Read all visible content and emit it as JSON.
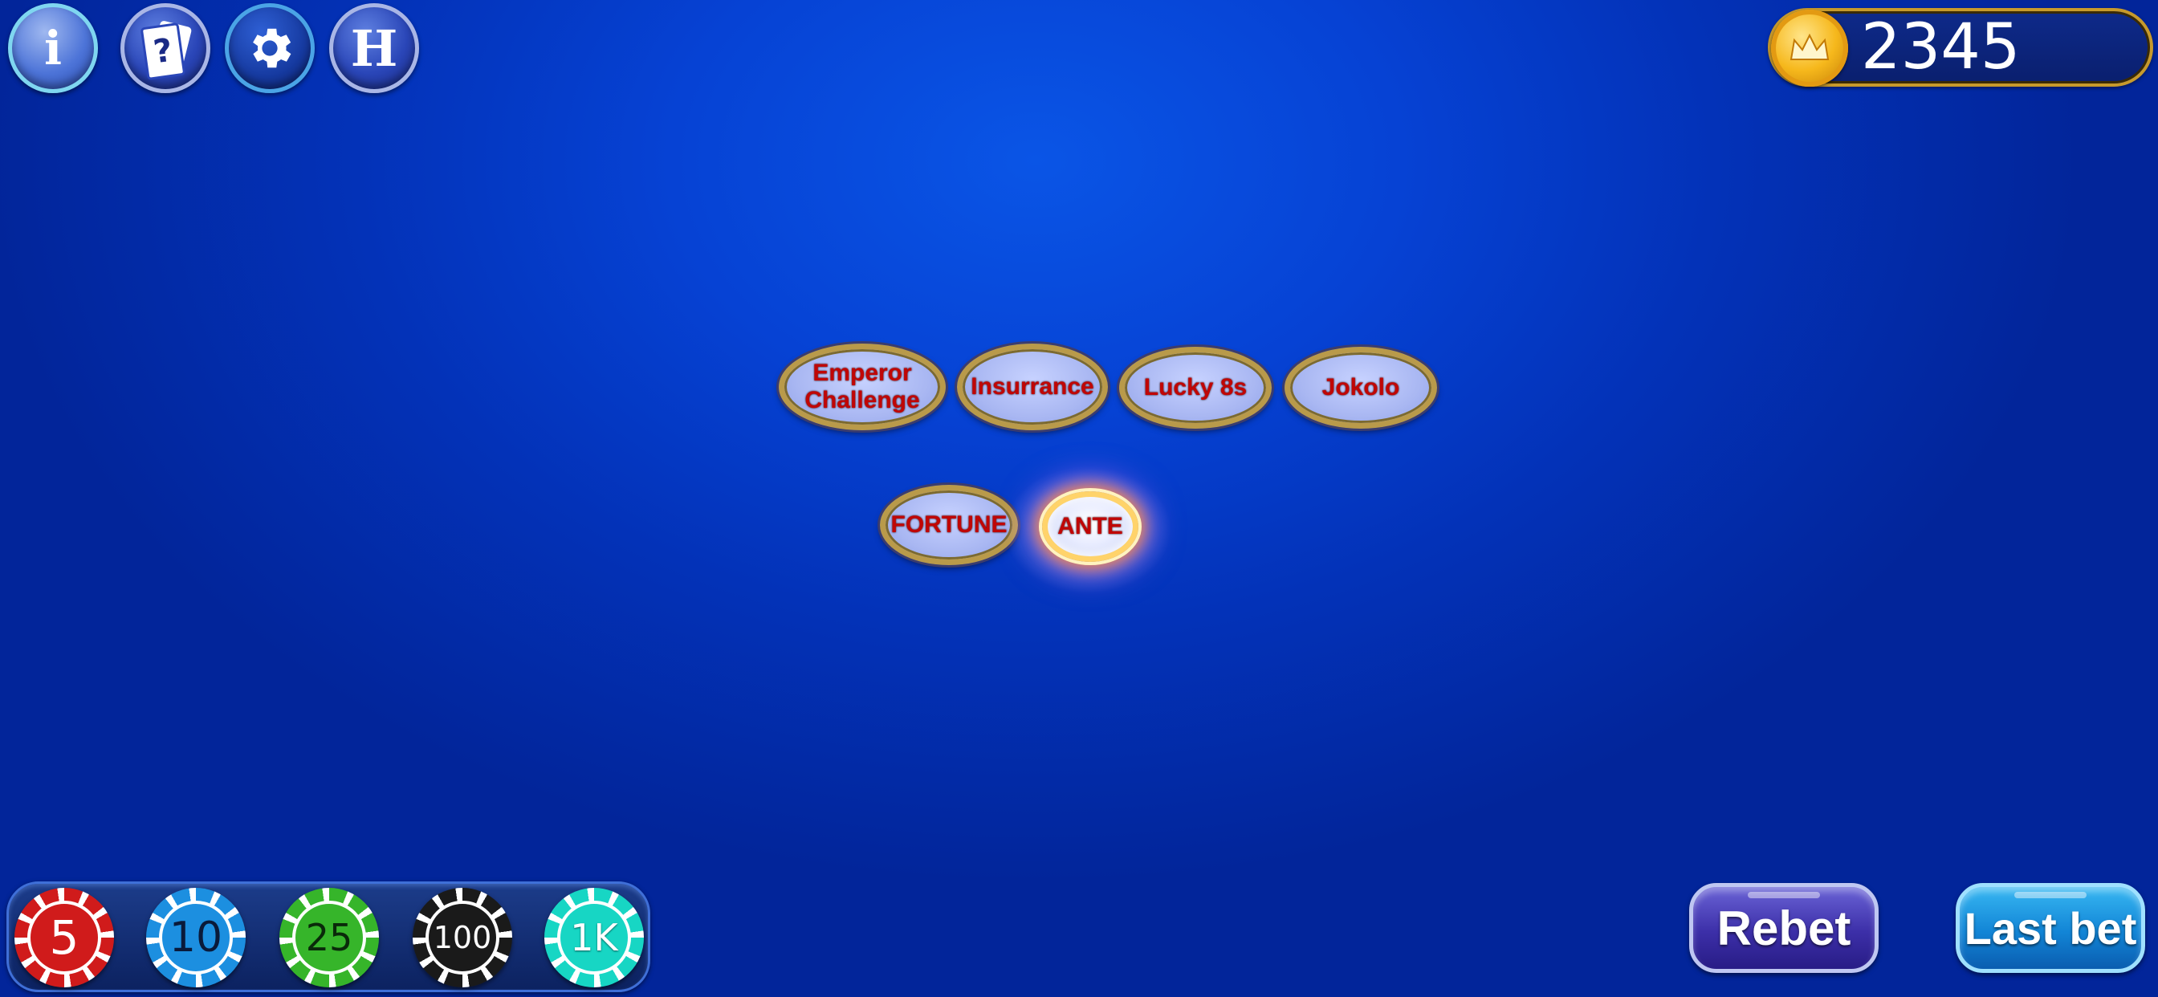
{
  "toolbar": {
    "info_glyph": "i",
    "cards_glyph": "?",
    "history_glyph": "H"
  },
  "icons": {
    "info": "info-icon",
    "rules": "cards-help-icon",
    "settings": "gear-icon",
    "history": "history-icon",
    "coin": "crown-coin-icon"
  },
  "balance": {
    "value": "2345"
  },
  "bet_spots": {
    "emperor_challenge": "Emperor\nChallenge",
    "insurrance": "Insurrance",
    "lucky8s": "Lucky 8s",
    "jokolo": "Jokolo",
    "fortune": "FORTUNE",
    "ante": "ANTE"
  },
  "chips": [
    {
      "label": "5",
      "color": "#d01b1b"
    },
    {
      "label": "10",
      "color": "#1c8fe0"
    },
    {
      "label": "25",
      "color": "#36b52a"
    },
    {
      "label": "100",
      "color": "#1a1a1a"
    },
    {
      "label": "1K",
      "color": "#17d6c4"
    }
  ],
  "actions": {
    "rebet": "Rebet",
    "last_bet": "Last bet"
  }
}
